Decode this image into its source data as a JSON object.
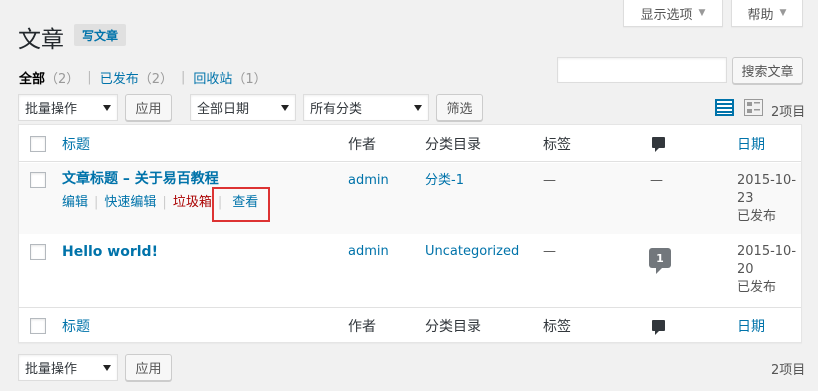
{
  "screen_options": {
    "display_label": "显示选项",
    "help_label": "帮助"
  },
  "header": {
    "title": "文章",
    "add_new": "写文章"
  },
  "filters_nav": {
    "all": {
      "label": "全部",
      "count": "（2）"
    },
    "published": {
      "label": "已发布",
      "count": "（2）"
    },
    "trash": {
      "label": "回收站",
      "count": "（1）"
    },
    "separator": "|"
  },
  "search": {
    "value": "",
    "button": "搜索文章"
  },
  "top_nav": {
    "bulk_action": "批量操作",
    "apply": "应用",
    "date_filter": "全部日期",
    "category_filter": "所有分类",
    "filter_button": "筛选",
    "items_count": "2项目"
  },
  "columns": {
    "title": "标题",
    "author": "作者",
    "categories": "分类目录",
    "tags": "标签",
    "date": "日期"
  },
  "posts": [
    {
      "title": "文章标题 – 关于易百教程",
      "author": "admin",
      "category": "分类-1",
      "tags": "—",
      "comments": "—",
      "date_line1": "2015-10-",
      "date_line2": "23",
      "status": "已发布",
      "actions": {
        "edit": "编辑",
        "quick_edit": "快速编辑",
        "trash": "垃圾箱",
        "view": "查看",
        "separator": "|"
      }
    },
    {
      "title": "Hello world!",
      "author": "admin",
      "category": "Uncategorized",
      "tags": "—",
      "comments": "1",
      "date_line1": "2015-10-",
      "date_line2": "20",
      "status": "已发布"
    }
  ],
  "bottom_nav": {
    "bulk_action": "批量操作",
    "apply": "应用",
    "items_count": "2项目"
  },
  "colors": {
    "link": "#0073aa",
    "trash": "#a00",
    "highlight": "#dd3333",
    "background": "#f1f1f1"
  },
  "icons": {
    "list_view": "list-view-icon",
    "excerpt_view": "excerpt-view-icon",
    "comments": "comment-icon"
  }
}
